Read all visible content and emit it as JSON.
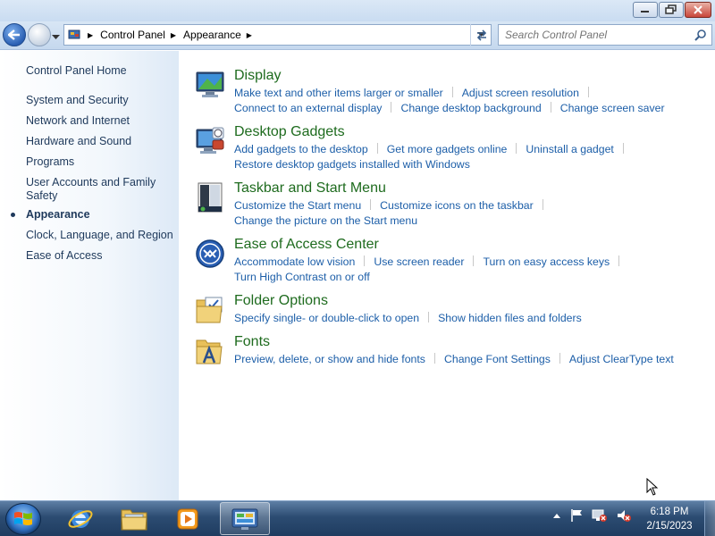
{
  "window": {
    "buttons": [
      "minimize-icon",
      "restore-icon",
      "close-icon"
    ]
  },
  "nav": {
    "breadcrumb": [
      "Control Panel",
      "Appearance"
    ],
    "search_placeholder": "Search Control Panel"
  },
  "sidebar": {
    "home": "Control Panel Home",
    "items": [
      {
        "label": "System and Security"
      },
      {
        "label": "Network and Internet"
      },
      {
        "label": "Hardware and Sound"
      },
      {
        "label": "Programs"
      },
      {
        "label": "User Accounts and Family Safety"
      },
      {
        "label": "Appearance",
        "active": true
      },
      {
        "label": "Clock, Language, and Region"
      },
      {
        "label": "Ease of Access"
      }
    ]
  },
  "categories": {
    "display": {
      "title": "Display",
      "row1": [
        "Make text and other items larger or smaller",
        "Adjust screen resolution"
      ],
      "row2": [
        "Connect to an external display",
        "Change desktop background",
        "Change screen saver"
      ]
    },
    "gadgets": {
      "title": "Desktop Gadgets",
      "row1": [
        "Add gadgets to the desktop",
        "Get more gadgets online",
        "Uninstall a gadget"
      ],
      "row2": [
        "Restore desktop gadgets installed with Windows"
      ]
    },
    "taskbar": {
      "title": "Taskbar and Start Menu",
      "row1": [
        "Customize the Start menu",
        "Customize icons on the taskbar"
      ],
      "row2": [
        "Change the picture on the Start menu"
      ]
    },
    "ease": {
      "title": "Ease of Access Center",
      "row1": [
        "Accommodate low vision",
        "Use screen reader",
        "Turn on easy access keys"
      ],
      "row2": [
        "Turn High Contrast on or off"
      ]
    },
    "folder": {
      "title": "Folder Options",
      "row1": [
        "Specify single- or double-click to open",
        "Show hidden files and folders"
      ]
    },
    "fonts": {
      "title": "Fonts",
      "row1": [
        "Preview, delete, or show and hide fonts",
        "Change Font Settings",
        "Adjust ClearType text"
      ]
    }
  },
  "taskbar": {
    "time": "6:18 PM",
    "date": "2/15/2023"
  },
  "colors": {
    "category_title": "#1e6b1e",
    "link": "#1c5ea8",
    "sidebar_text": "#1e395b"
  }
}
